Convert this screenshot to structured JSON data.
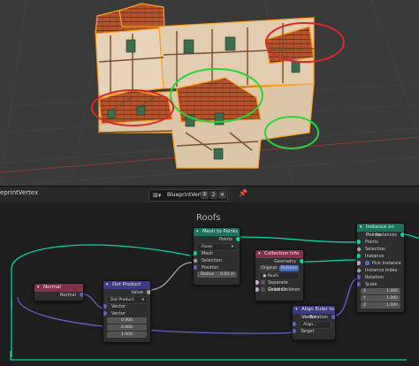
{
  "header": {
    "tree_label": "eprintVertex",
    "tree_name": "BlueprintVertex",
    "shield_glyph": "⛨",
    "user_count": "2"
  },
  "frame": {
    "title": "Roofs"
  },
  "nodes": {
    "mesh_to_points": {
      "title": "Mesh to Points",
      "output": "Points",
      "mode": "Faces",
      "in_mesh": "Mesh",
      "in_selection": "Selection",
      "in_position": "Position",
      "radius_label": "Radius",
      "radius_value": "0.05 m"
    },
    "normal": {
      "title": "Normal",
      "output": "Normal"
    },
    "dot_product": {
      "title": "Dot Product",
      "output": "Value",
      "mode": "Dot Product",
      "in_vector1": "Vector",
      "in_vector2": "Vector",
      "vec_x": "0.000",
      "vec_y": "0.000",
      "vec_z": "1.000"
    },
    "collection_info": {
      "title": "Collection Info",
      "output": "Geometry",
      "toggle_original": "Original",
      "toggle_relative": "Relative",
      "collection": "Roofs",
      "separate": "Separate Children",
      "reset": "Reset Children"
    },
    "align": {
      "title": "Align Euler to Vector",
      "output": "Rotation",
      "axis_label": "Align...",
      "in_factor": "Factor",
      "in_target": "Target"
    },
    "instance_on_points": {
      "title": "Instance on Points",
      "output": "Instances",
      "in_points": "Points",
      "in_selection": "Selection",
      "in_instance": "Instance",
      "pick_label": "Pick Instance",
      "in_index": "Instance Index",
      "in_rotation": "Rotation",
      "scale_label": "Scale",
      "sx_label": "X",
      "sx": "1.000",
      "sy_label": "Y",
      "sy": "1.000",
      "sz_label": "Z",
      "sz": "1.000"
    }
  },
  "colors": {
    "geo_header": "#1d725e",
    "input_header": "#83314a",
    "vector_header": "#3c3c83",
    "frame_bg": "#1e1e1e",
    "accent": "#4772b3"
  }
}
